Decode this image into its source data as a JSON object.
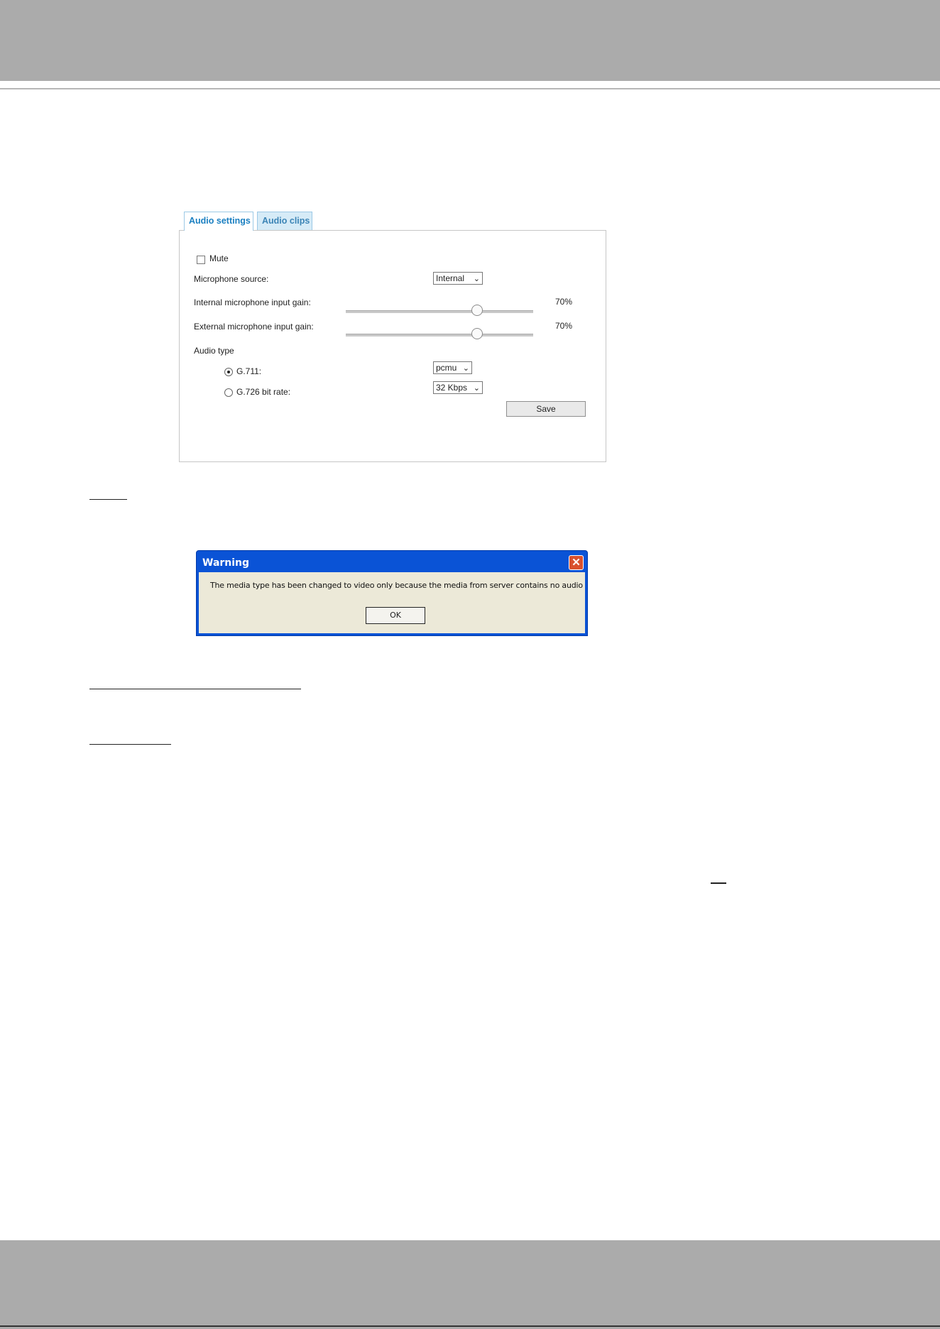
{
  "audio_panel": {
    "tabs": [
      {
        "label": "Audio settings"
      },
      {
        "label": "Audio clips"
      }
    ],
    "mute_label": "Mute",
    "microphone_source": {
      "label": "Microphone source:",
      "value": "Internal"
    },
    "internal_gain": {
      "label": "Internal microphone input gain:",
      "value_text": "70%",
      "level": 0.7
    },
    "external_gain": {
      "label": "External microphone input gain:",
      "value_text": "70%",
      "level": 0.7
    },
    "audio_type_label": "Audio type",
    "g711": {
      "label": "G.711:",
      "value": "pcmu",
      "selected": true
    },
    "g726": {
      "label": "G.726 bit rate:",
      "value": "32 Kbps",
      "selected": false
    },
    "save_label": "Save"
  },
  "warning_dialog": {
    "title": "Warning",
    "message": "The media type has been changed to video only because the media from server contains no audio",
    "ok_label": "OK"
  }
}
